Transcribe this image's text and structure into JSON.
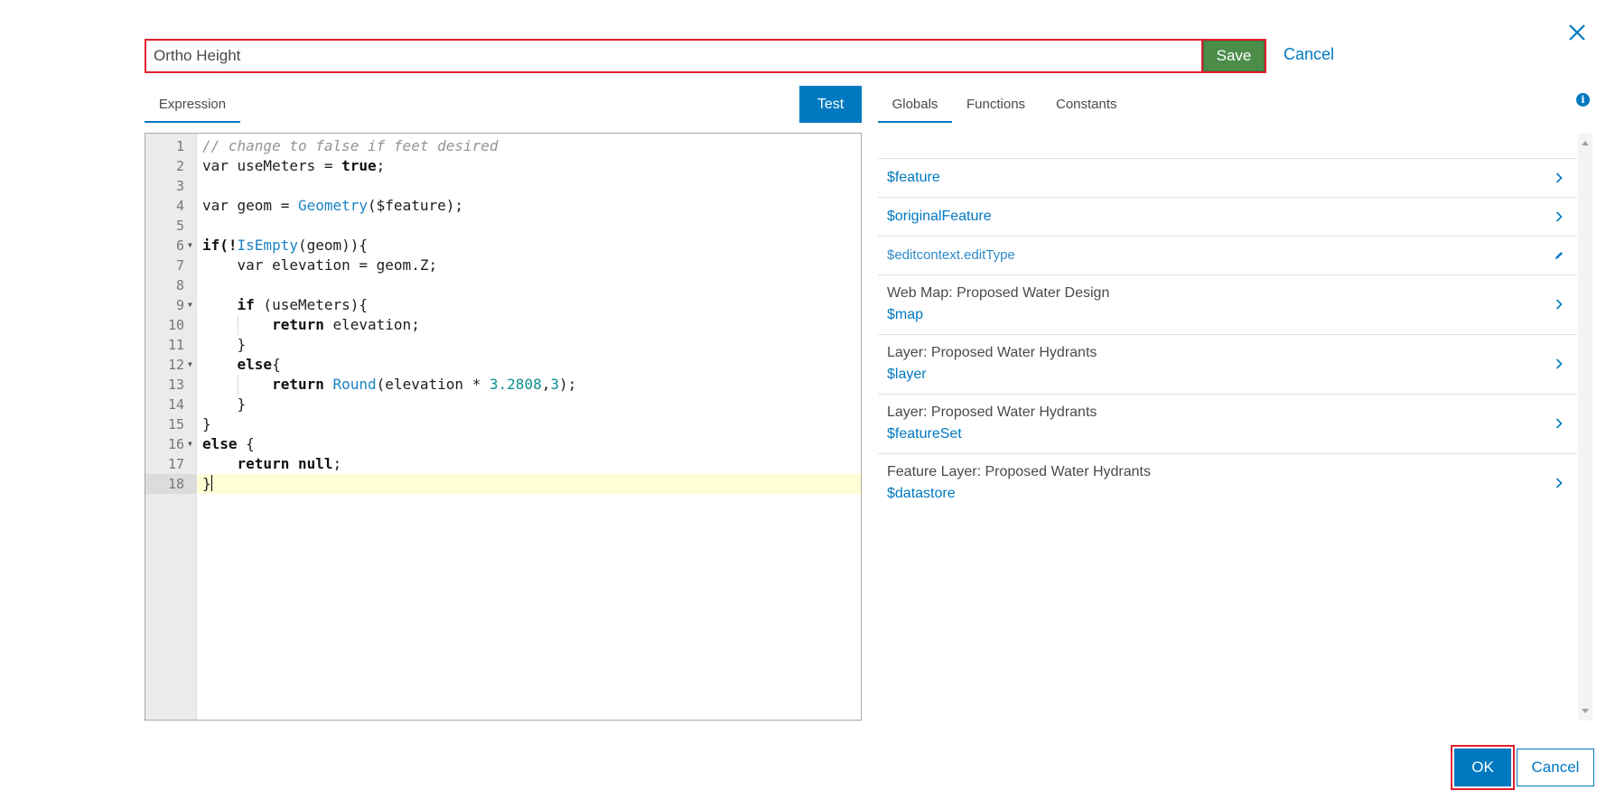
{
  "dialog": {
    "expression_name": "Ortho Height",
    "save_label": "Save",
    "cancel_label": "Cancel"
  },
  "editor": {
    "tab_label": "Expression",
    "test_label": "Test",
    "active_line": 18,
    "lines": [
      {
        "n": "1",
        "fold": false
      },
      {
        "n": "2",
        "fold": false
      },
      {
        "n": "3",
        "fold": false
      },
      {
        "n": "4",
        "fold": false
      },
      {
        "n": "5",
        "fold": false
      },
      {
        "n": "6",
        "fold": true
      },
      {
        "n": "7",
        "fold": false
      },
      {
        "n": "8",
        "fold": false
      },
      {
        "n": "9",
        "fold": true
      },
      {
        "n": "10",
        "fold": false
      },
      {
        "n": "11",
        "fold": false
      },
      {
        "n": "12",
        "fold": true
      },
      {
        "n": "13",
        "fold": false
      },
      {
        "n": "14",
        "fold": false
      },
      {
        "n": "15",
        "fold": false
      },
      {
        "n": "16",
        "fold": true
      },
      {
        "n": "17",
        "fold": false
      },
      {
        "n": "18",
        "fold": false
      }
    ],
    "code": {
      "l1": "// change to false if feet desired",
      "l2_a": "var useMeters = ",
      "l2_b": "true",
      "l2_c": ";",
      "l4_a": "var geom = ",
      "l4_b": "Geometry",
      "l4_c": "($feature);",
      "l6_a": "if",
      "l6_b": "(!",
      "l6_c": "IsEmpty",
      "l6_d": "(geom)){",
      "l7": "var elevation = geom.Z;",
      "l9_a": "if",
      "l9_b": " (useMeters){",
      "l10_a": "return",
      "l10_b": " elevation;",
      "l11": "}",
      "l12_a": "else",
      "l12_b": "{",
      "l13_a": "return",
      "l13_b": " ",
      "l13_c": "Round",
      "l13_d": "(elevation * ",
      "l13_e": "3.2808",
      "l13_f": ",",
      "l13_g": "3",
      "l13_h": ");",
      "l14": "}",
      "l15": "}",
      "l16_a": "else",
      "l16_b": " {",
      "l17_a": "return",
      "l17_b": " ",
      "l17_c": "null",
      "l17_d": ";",
      "l18": "}"
    }
  },
  "side_panel": {
    "tabs": [
      "Globals",
      "Functions",
      "Constants"
    ],
    "active_tab": "Globals",
    "items": [
      {
        "label": "",
        "value": "$feature",
        "icon": "chevron-right-icon"
      },
      {
        "label": "",
        "value": "$originalFeature",
        "icon": "chevron-right-icon"
      },
      {
        "label": "",
        "value": "$editcontext.editType",
        "icon": "pencil-icon"
      },
      {
        "label": "Web Map: Proposed Water Design",
        "value": "$map",
        "icon": "chevron-right-icon"
      },
      {
        "label": "Layer: Proposed Water Hydrants",
        "value": "$layer",
        "icon": "chevron-right-icon"
      },
      {
        "label": "Layer: Proposed Water Hydrants",
        "value": "$featureSet",
        "icon": "chevron-right-icon"
      },
      {
        "label": "Feature Layer: Proposed Water Hydrants",
        "value": "$datastore",
        "icon": "chevron-right-icon"
      }
    ]
  },
  "footer": {
    "ok_label": "OK",
    "cancel_label": "Cancel"
  },
  "colors": {
    "accent": "#0079c1",
    "save_green": "#4c8d4a",
    "highlight_red": "#e0202e",
    "active_line": "#fffed4"
  }
}
